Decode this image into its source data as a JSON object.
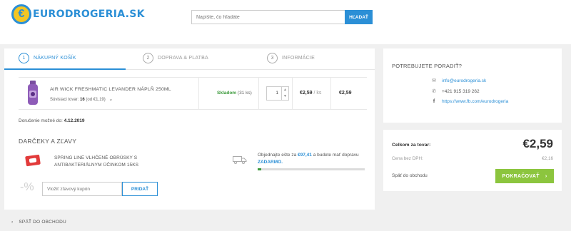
{
  "header": {
    "logo_text": "EURODROGERIA.SK",
    "logo_symbol": "€",
    "search_placeholder": "Napíšte, čo hľadáte",
    "search_button": "HĽADAŤ"
  },
  "steps": [
    {
      "num": "1",
      "label": "NÁKUPNÝ KOŠÍK",
      "active": true
    },
    {
      "num": "2",
      "label": "DOPRAVA & PLATBA",
      "active": false
    },
    {
      "num": "3",
      "label": "INFORMÁCIE",
      "active": false
    }
  ],
  "product": {
    "name": "AIR WICK FRESHMATIC LEVANDER NÁPLŇ 250ML",
    "related_prefix": "Súvisiaci tovar:",
    "related_count": "16",
    "related_from": "(od €1,19)",
    "stock_status": "Skladom",
    "stock_qty": "(31 ks)",
    "quantity": "1",
    "unit_price": "€2,59",
    "unit": "/ ks",
    "total_price": "€2,59"
  },
  "delivery": {
    "label": "Doručenie možné do:",
    "date": "4.12.2019"
  },
  "gifts": {
    "title": "DARČEKY A ZĽAVY",
    "gift_name": "SPRING LINE VLHČENÉ OBRÚSKY S ANTIBAKTERIÁLNYM ÚČINKOM 15KS",
    "shipping_text_1": "Objednajte ešte za",
    "shipping_amount": "€97,41",
    "shipping_text_2": "a budete mať dopravu",
    "shipping_free": "ZADARMO.",
    "shipping_progress": 0.03
  },
  "coupon": {
    "icon": "-%",
    "placeholder": "Vložiť zľavový kupón",
    "button": "PRIDAŤ"
  },
  "back_link": "SPÄŤ DO OBCHODU",
  "help": {
    "title": "POTREBUJETE PORADIŤ?",
    "email": "info@eurodrogeria.sk",
    "phone": "+421 915 319 262",
    "facebook": "https://www.fb.com/eurodrogeria"
  },
  "summary": {
    "total_label": "Celkom za tovar:",
    "total": "€2,59",
    "vat_label": "Cena bez DPH:",
    "vat_value": "€2,16",
    "back_label": "Späť do obchodu",
    "continue_label": "POKRAČOVAŤ"
  },
  "colors": {
    "accent": "#2b8fd6",
    "success": "#3c9a3c",
    "continue": "#8cc53e"
  }
}
